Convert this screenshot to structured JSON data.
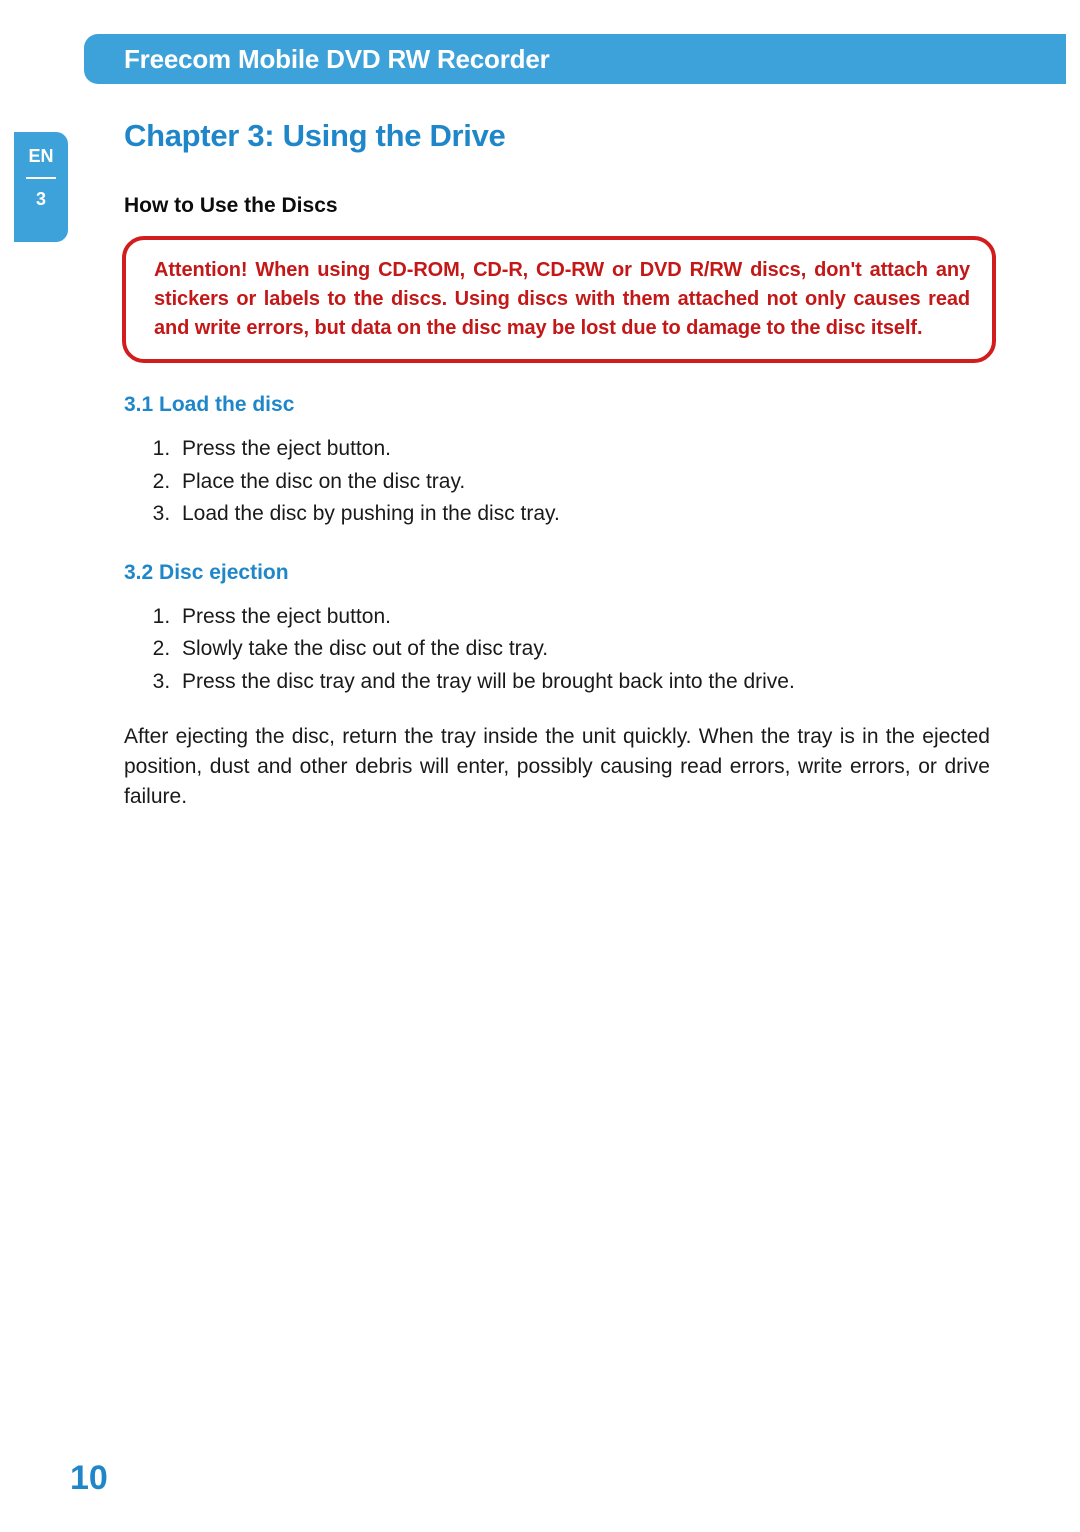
{
  "header": {
    "title": "Freecom Mobile DVD RW Recorder"
  },
  "sideTab": {
    "lang": "EN",
    "chapter": "3"
  },
  "chapterTitle": "Chapter 3:   Using the Drive",
  "sectionTitle": "How to Use the Discs",
  "warning": "Attention! When using CD-ROM, CD-R, CD-RW or DVD R/RW discs, don't attach any stickers or labels to the discs. Using discs with them attached not only causes read and write errors, but data on the disc may be lost due to damage to the disc itself.",
  "sub1": {
    "heading": "3.1   Load the disc",
    "items": [
      "Press the eject button.",
      "Place the disc on the disc tray.",
      "Load the disc by pushing in the disc tray."
    ]
  },
  "sub2": {
    "heading": "3.2   Disc ejection",
    "items": [
      "Press the eject button.",
      "Slowly take the disc out of the disc tray.",
      "Press the disc tray and the tray will be brought back into the drive."
    ]
  },
  "afterNote": "After ejecting the disc, return the tray inside the unit quickly. When the tray is in the ejected position, dust and other debris will enter, possibly causing read errors, write errors, or drive failure.",
  "pageNumber": "10"
}
